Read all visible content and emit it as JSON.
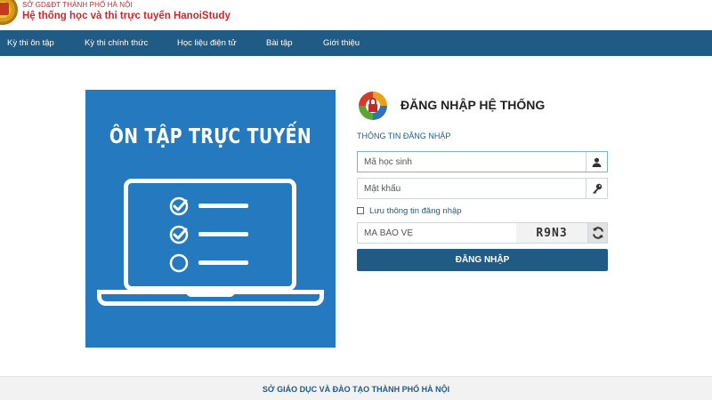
{
  "header": {
    "org_name": "SỞ GD&ĐT THÀNH PHỐ HÀ NỘI",
    "site_name": "Hệ thống học và thi trực tuyến HanoiStudy"
  },
  "nav": {
    "items": [
      {
        "label": "Kỳ thi ôn tập"
      },
      {
        "label": "Kỳ thi chính thức"
      },
      {
        "label": "Học liệu điện tử"
      },
      {
        "label": "Bài tập"
      },
      {
        "label": "Giới thiệu"
      }
    ]
  },
  "banner": {
    "title": "ÔN TẬP TRỰC TUYẾN"
  },
  "login": {
    "title": "ĐĂNG NHẬP HỆ THỐNG",
    "section_label": "THÔNG TIN ĐĂNG NHẬP",
    "username_placeholder": "Mã học sinh",
    "password_placeholder": "Mật khẩu",
    "remember_label": "Lưu thông tin đăng nhập",
    "captcha_placeholder": "MÃ BẢO VỆ",
    "captcha_text": "R9N3",
    "submit_label": "ĐĂNG NHẬP",
    "icons": {
      "username": "user-icon",
      "password": "key-icon",
      "refresh": "refresh-icon"
    }
  },
  "footer": {
    "text": "SỞ GIÁO DỤC VÀ ĐÀO TẠO THÀNH PHỐ HÀ NỘI"
  },
  "colors": {
    "primary": "#1f5b85",
    "brand_red": "#c8282e",
    "banner_blue": "#2479bf"
  }
}
